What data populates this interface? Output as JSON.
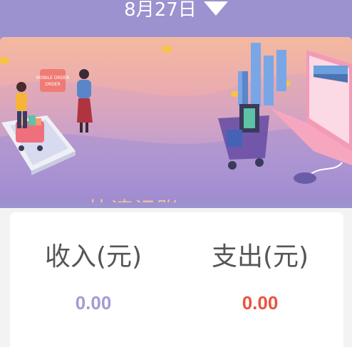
{
  "header": {
    "date": "8月27日",
    "dropdown_icon": "caret-down-icon"
  },
  "banner": {
    "title": "快速记账",
    "tag_text": "MOBILE ORDER"
  },
  "summary": {
    "income_label": "收入(元)",
    "income_value": "0.00",
    "expense_label": "支出(元)",
    "expense_value": "0.00",
    "colors": {
      "income": "#a59ad3",
      "expense": "#e9523f",
      "header": "#9b92cf"
    }
  }
}
